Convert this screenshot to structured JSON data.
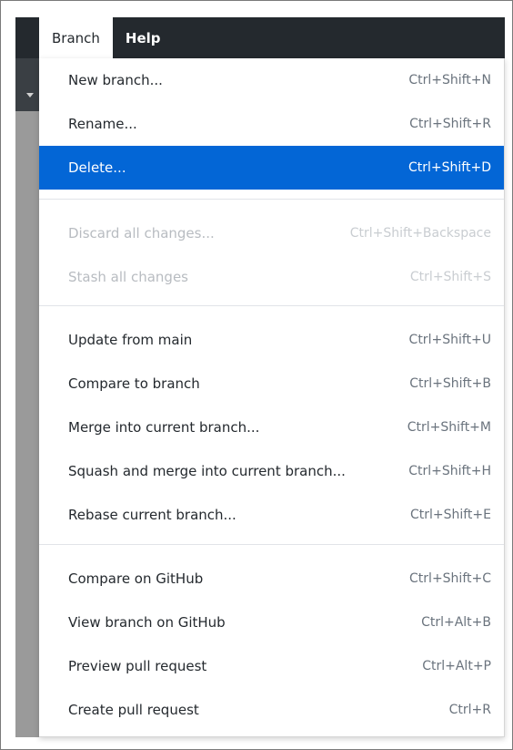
{
  "menubar": {
    "items": [
      {
        "label": "Branch"
      },
      {
        "label": "Help"
      }
    ]
  },
  "menu": {
    "items": [
      {
        "label": "New branch...",
        "shortcut": "Ctrl+Shift+N"
      },
      {
        "label": "Rename...",
        "shortcut": "Ctrl+Shift+R"
      },
      {
        "label": "Delete...",
        "shortcut": "Ctrl+Shift+D"
      },
      {
        "label": "Discard all changes...",
        "shortcut": "Ctrl+Shift+Backspace"
      },
      {
        "label": "Stash all changes",
        "shortcut": "Ctrl+Shift+S"
      },
      {
        "label": "Update from main",
        "shortcut": "Ctrl+Shift+U"
      },
      {
        "label": "Compare to branch",
        "shortcut": "Ctrl+Shift+B"
      },
      {
        "label": "Merge into current branch...",
        "shortcut": "Ctrl+Shift+M"
      },
      {
        "label": "Squash and merge into current branch...",
        "shortcut": "Ctrl+Shift+H"
      },
      {
        "label": "Rebase current branch...",
        "shortcut": "Ctrl+Shift+E"
      },
      {
        "label": "Compare on GitHub",
        "shortcut": "Ctrl+Shift+C"
      },
      {
        "label": "View branch on GitHub",
        "shortcut": "Ctrl+Alt+B"
      },
      {
        "label": "Preview pull request",
        "shortcut": "Ctrl+Alt+P"
      },
      {
        "label": "Create pull request",
        "shortcut": "Ctrl+R"
      }
    ]
  },
  "colors": {
    "menubar_bg": "#24292e",
    "selected_bg": "#0366d6",
    "disabled_text": "#b8bcc1"
  }
}
